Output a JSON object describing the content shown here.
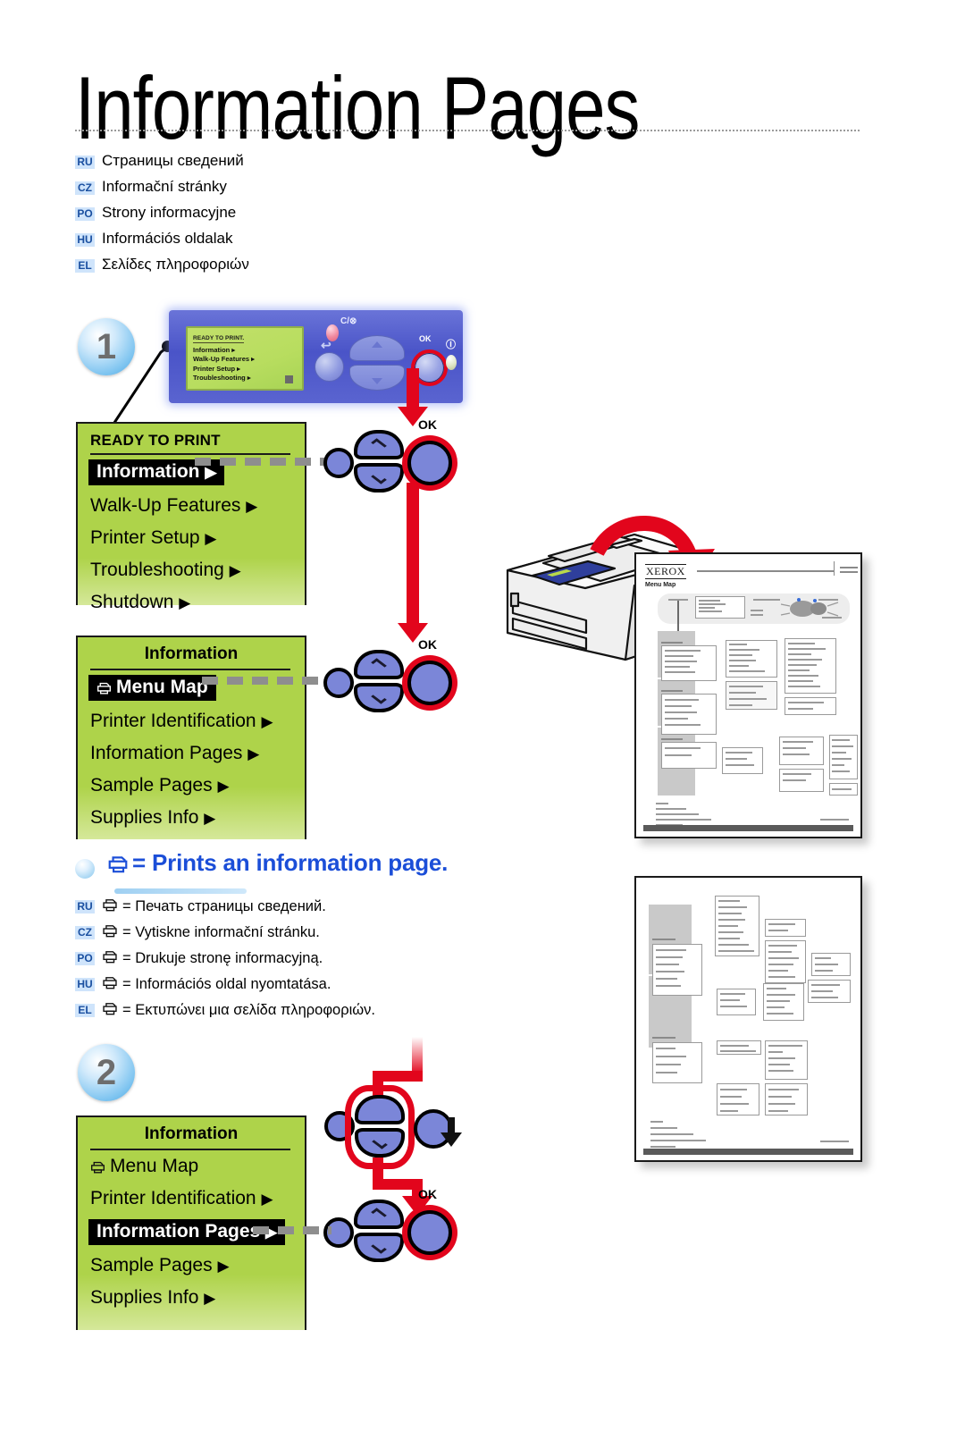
{
  "header": {
    "title": "Information Pages",
    "translations": [
      {
        "code": "RU",
        "text": "Страницы сведений"
      },
      {
        "code": "CZ",
        "text": "Informační stránky"
      },
      {
        "code": "PO",
        "text": "Strony informacyjne"
      },
      {
        "code": "HU",
        "text": "Információs oldalak"
      },
      {
        "code": "EL",
        "text": "Σελίδες πληροφοριών"
      }
    ]
  },
  "steps": {
    "one": "1",
    "two": "2"
  },
  "control_panel": {
    "screen": {
      "status": "READY TO PRINT.",
      "items": [
        "Information ▸",
        "Walk-Up Features ▸",
        "Printer Setup ▸",
        "Troubleshooting ▸"
      ]
    },
    "ok_label": "OK",
    "cancel_label": "C/⊗",
    "info_label": "Ⓘ",
    "back_label": "↩"
  },
  "menu_ready": {
    "status": "READY TO PRINT",
    "selected": "Information",
    "items": [
      "Walk-Up Features",
      "Printer Setup",
      "Troubleshooting",
      "Shutdown"
    ],
    "caret": "▶"
  },
  "menu_information_1": {
    "title": "Information",
    "selected": "Menu Map",
    "items": [
      "Printer Identification",
      "Information Pages",
      "Sample Pages",
      "Supplies Info"
    ],
    "caret": "▶"
  },
  "menu_information_2": {
    "title": "Information",
    "first_item": "Menu Map",
    "second_item": "Printer Identification",
    "selected": "Information Pages",
    "items": [
      "Sample Pages",
      "Supplies Info"
    ],
    "caret": "▶"
  },
  "legend": {
    "heading": "= Prints an information page.",
    "translations": [
      {
        "code": "RU",
        "text": "= Печать страницы сведений."
      },
      {
        "code": "CZ",
        "text": "= Vytiskne informační stránku."
      },
      {
        "code": "PO",
        "text": "= Drukuje stronę informacyjną."
      },
      {
        "code": "HU",
        "text": "= Információs oldal nyomtatása."
      },
      {
        "code": "EL",
        "text": "= Εκτυπώνει μια σελίδα πληροφοριών."
      }
    ]
  },
  "navpad_labels": {
    "ok": "OK"
  },
  "printed_page": {
    "brand": "XEROX",
    "subtitle": "Menu Map"
  },
  "colors": {
    "accent_red": "#e2051c",
    "menu_green": "#aed34a",
    "panel_blue": "#4a54c8",
    "heading_blue": "#1b4ed8",
    "lang_tag_bg": "#cfe4fb",
    "lang_tag_fg": "#1a4fa0"
  }
}
